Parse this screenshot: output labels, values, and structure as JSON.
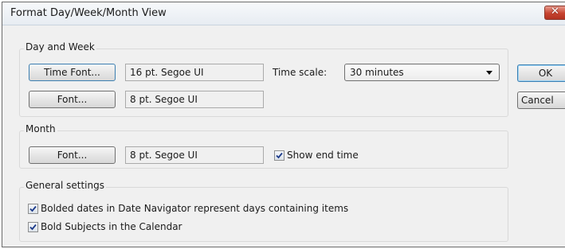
{
  "dialog": {
    "title": "Format Day/Week/Month View",
    "close_glyph": "✕"
  },
  "day_week": {
    "legend": "Day and Week",
    "time_font_button": "Time Font...",
    "time_font_value": "16 pt. Segoe UI",
    "font_button": "Font...",
    "font_value": "8 pt. Segoe UI",
    "time_scale_label": "Time scale:",
    "time_scale_value": "30 minutes"
  },
  "month": {
    "legend": "Month",
    "font_button": "Font...",
    "font_value": "8 pt. Segoe UI",
    "show_end_time_label": "Show end time",
    "show_end_time_checked": true
  },
  "general": {
    "legend": "General settings",
    "bolded_dates_label": "Bolded dates in Date Navigator represent days containing items",
    "bolded_dates_checked": true,
    "bold_subjects_label": "Bold Subjects in the Calendar",
    "bold_subjects_checked": true
  },
  "actions": {
    "ok": "OK",
    "cancel": "Cancel"
  },
  "colors": {
    "dialog_bg": "#f0f0f0",
    "check_color": "#1c3a8a",
    "close_red": "#c7432f"
  }
}
